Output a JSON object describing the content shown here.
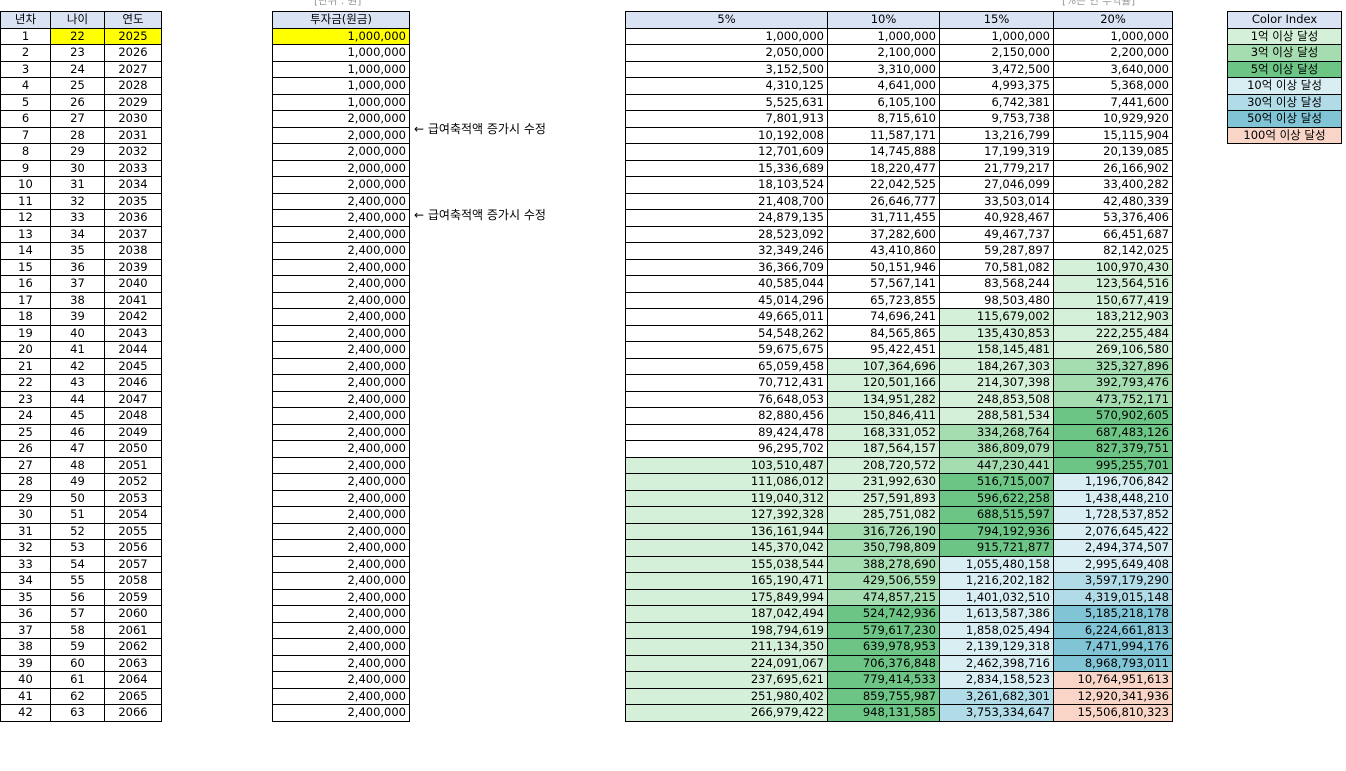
{
  "captions": {
    "unit": "[단위 : 원]",
    "rate": "[%는 연 수익률]"
  },
  "headers": {
    "year_no": "년차",
    "age": "나이",
    "year": "연도",
    "investment": "투자금(원금)"
  },
  "rate_headers": [
    "5%",
    "10%",
    "15%",
    "20%"
  ],
  "notes": [
    "← 급여축적액 증가시 수정",
    "← 급여축적액 증가시 수정"
  ],
  "colors": {
    "highlight": "#ffff00",
    "header_bg": "#dae3f3",
    "tier1": "#d5f0d8",
    "tier2": "#a5dcb0",
    "tier3": "#6cc585",
    "tier4": "#d9eef3",
    "tier5": "#b0dbe7",
    "tier6": "#80c4d6",
    "tier7": "#f9d5c8"
  },
  "legend": {
    "title": "Color Index",
    "items": [
      {
        "label": "1억 이상 달성",
        "tier": 1
      },
      {
        "label": "3억 이상 달성",
        "tier": 2
      },
      {
        "label": "5억 이상 달성",
        "tier": 3
      },
      {
        "label": "10억 이상 달성",
        "tier": 4
      },
      {
        "label": "30억 이상 달성",
        "tier": 5
      },
      {
        "label": "50억 이상 달성",
        "tier": 6
      },
      {
        "label": "100억 이상 달성",
        "tier": 7
      }
    ]
  },
  "rows": [
    [
      "1",
      "22",
      "2025",
      "1,000,000",
      "1,000,000",
      "1,000,000",
      "1,000,000",
      "1,000,000"
    ],
    [
      "2",
      "23",
      "2026",
      "1,000,000",
      "2,050,000",
      "2,100,000",
      "2,150,000",
      "2,200,000"
    ],
    [
      "3",
      "24",
      "2027",
      "1,000,000",
      "3,152,500",
      "3,310,000",
      "3,472,500",
      "3,640,000"
    ],
    [
      "4",
      "25",
      "2028",
      "1,000,000",
      "4,310,125",
      "4,641,000",
      "4,993,375",
      "5,368,000"
    ],
    [
      "5",
      "26",
      "2029",
      "1,000,000",
      "5,525,631",
      "6,105,100",
      "6,742,381",
      "7,441,600"
    ],
    [
      "6",
      "27",
      "2030",
      "2,000,000",
      "7,801,913",
      "8,715,610",
      "9,753,738",
      "10,929,920"
    ],
    [
      "7",
      "28",
      "2031",
      "2,000,000",
      "10,192,008",
      "11,587,171",
      "13,216,799",
      "15,115,904"
    ],
    [
      "8",
      "29",
      "2032",
      "2,000,000",
      "12,701,609",
      "14,745,888",
      "17,199,319",
      "20,139,085"
    ],
    [
      "9",
      "30",
      "2033",
      "2,000,000",
      "15,336,689",
      "18,220,477",
      "21,779,217",
      "26,166,902"
    ],
    [
      "10",
      "31",
      "2034",
      "2,000,000",
      "18,103,524",
      "22,042,525",
      "27,046,099",
      "33,400,282"
    ],
    [
      "11",
      "32",
      "2035",
      "2,400,000",
      "21,408,700",
      "26,646,777",
      "33,503,014",
      "42,480,339"
    ],
    [
      "12",
      "33",
      "2036",
      "2,400,000",
      "24,879,135",
      "31,711,455",
      "40,928,467",
      "53,376,406"
    ],
    [
      "13",
      "34",
      "2037",
      "2,400,000",
      "28,523,092",
      "37,282,600",
      "49,467,737",
      "66,451,687"
    ],
    [
      "14",
      "35",
      "2038",
      "2,400,000",
      "32,349,246",
      "43,410,860",
      "59,287,897",
      "82,142,025"
    ],
    [
      "15",
      "36",
      "2039",
      "2,400,000",
      "36,366,709",
      "50,151,946",
      "70,581,082",
      "100,970,430"
    ],
    [
      "16",
      "37",
      "2040",
      "2,400,000",
      "40,585,044",
      "57,567,141",
      "83,568,244",
      "123,564,516"
    ],
    [
      "17",
      "38",
      "2041",
      "2,400,000",
      "45,014,296",
      "65,723,855",
      "98,503,480",
      "150,677,419"
    ],
    [
      "18",
      "39",
      "2042",
      "2,400,000",
      "49,665,011",
      "74,696,241",
      "115,679,002",
      "183,212,903"
    ],
    [
      "19",
      "40",
      "2043",
      "2,400,000",
      "54,548,262",
      "84,565,865",
      "135,430,853",
      "222,255,484"
    ],
    [
      "20",
      "41",
      "2044",
      "2,400,000",
      "59,675,675",
      "95,422,451",
      "158,145,481",
      "269,106,580"
    ],
    [
      "21",
      "42",
      "2045",
      "2,400,000",
      "65,059,458",
      "107,364,696",
      "184,267,303",
      "325,327,896"
    ],
    [
      "22",
      "43",
      "2046",
      "2,400,000",
      "70,712,431",
      "120,501,166",
      "214,307,398",
      "392,793,476"
    ],
    [
      "23",
      "44",
      "2047",
      "2,400,000",
      "76,648,053",
      "134,951,282",
      "248,853,508",
      "473,752,171"
    ],
    [
      "24",
      "45",
      "2048",
      "2,400,000",
      "82,880,456",
      "150,846,411",
      "288,581,534",
      "570,902,605"
    ],
    [
      "25",
      "46",
      "2049",
      "2,400,000",
      "89,424,478",
      "168,331,052",
      "334,268,764",
      "687,483,126"
    ],
    [
      "26",
      "47",
      "2050",
      "2,400,000",
      "96,295,702",
      "187,564,157",
      "386,809,079",
      "827,379,751"
    ],
    [
      "27",
      "48",
      "2051",
      "2,400,000",
      "103,510,487",
      "208,720,572",
      "447,230,441",
      "995,255,701"
    ],
    [
      "28",
      "49",
      "2052",
      "2,400,000",
      "111,086,012",
      "231,992,630",
      "516,715,007",
      "1,196,706,842"
    ],
    [
      "29",
      "50",
      "2053",
      "2,400,000",
      "119,040,312",
      "257,591,893",
      "596,622,258",
      "1,438,448,210"
    ],
    [
      "30",
      "51",
      "2054",
      "2,400,000",
      "127,392,328",
      "285,751,082",
      "688,515,597",
      "1,728,537,852"
    ],
    [
      "31",
      "52",
      "2055",
      "2,400,000",
      "136,161,944",
      "316,726,190",
      "794,192,936",
      "2,076,645,422"
    ],
    [
      "32",
      "53",
      "2056",
      "2,400,000",
      "145,370,042",
      "350,798,809",
      "915,721,877",
      "2,494,374,507"
    ],
    [
      "33",
      "54",
      "2057",
      "2,400,000",
      "155,038,544",
      "388,278,690",
      "1,055,480,158",
      "2,995,649,408"
    ],
    [
      "34",
      "55",
      "2058",
      "2,400,000",
      "165,190,471",
      "429,506,559",
      "1,216,202,182",
      "3,597,179,290"
    ],
    [
      "35",
      "56",
      "2059",
      "2,400,000",
      "175,849,994",
      "474,857,215",
      "1,401,032,510",
      "4,319,015,148"
    ],
    [
      "36",
      "57",
      "2060",
      "2,400,000",
      "187,042,494",
      "524,742,936",
      "1,613,587,386",
      "5,185,218,178"
    ],
    [
      "37",
      "58",
      "2061",
      "2,400,000",
      "198,794,619",
      "579,617,230",
      "1,858,025,494",
      "6,224,661,813"
    ],
    [
      "38",
      "59",
      "2062",
      "2,400,000",
      "211,134,350",
      "639,978,953",
      "2,139,129,318",
      "7,471,994,176"
    ],
    [
      "39",
      "60",
      "2063",
      "2,400,000",
      "224,091,067",
      "706,376,848",
      "2,462,398,716",
      "8,968,793,011"
    ],
    [
      "40",
      "61",
      "2064",
      "2,400,000",
      "237,695,621",
      "779,414,533",
      "2,834,158,523",
      "10,764,951,613"
    ],
    [
      "41",
      "62",
      "2065",
      "2,400,000",
      "251,980,402",
      "859,755,987",
      "3,261,682,301",
      "12,920,341,936"
    ],
    [
      "42",
      "63",
      "2066",
      "2,400,000",
      "266,979,422",
      "948,131,585",
      "3,753,334,647",
      "15,506,810,323"
    ]
  ]
}
